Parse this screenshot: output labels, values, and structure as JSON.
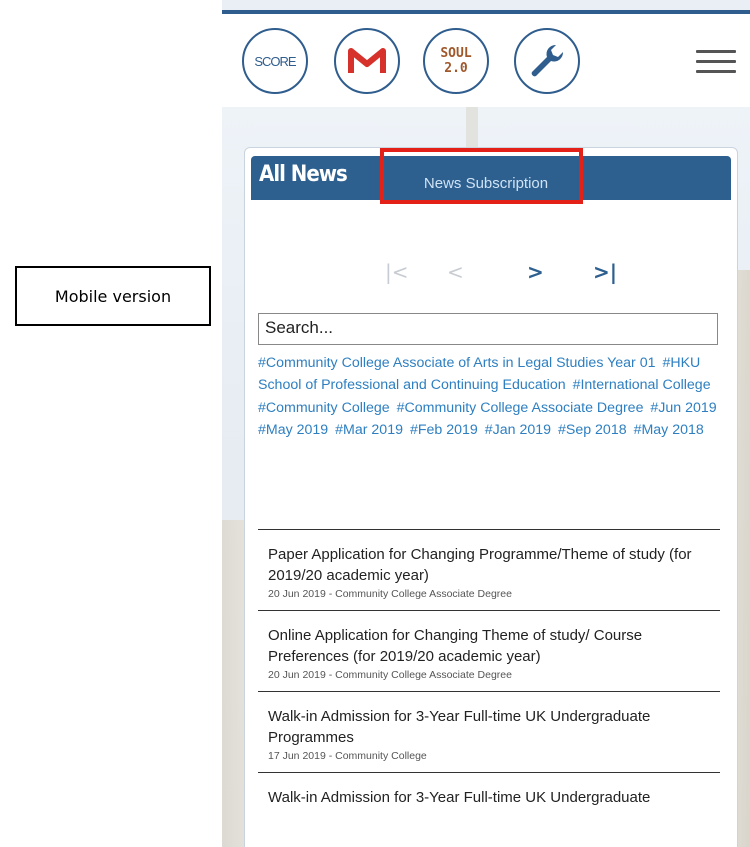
{
  "annotation": {
    "label": "Mobile version"
  },
  "topbar": {
    "icons": [
      {
        "name": "score-icon",
        "label": "SCORE"
      },
      {
        "name": "gmail-icon",
        "label": ""
      },
      {
        "name": "soul-icon",
        "label_line1": "SOUL",
        "label_line2": "2.0"
      },
      {
        "name": "wrench-icon",
        "label": ""
      }
    ],
    "menu_icon": "hamburger-menu-icon"
  },
  "news": {
    "heading": "All News",
    "subscription_label": "News Subscription",
    "pager": {
      "first": "|<",
      "prev": "<",
      "next": ">",
      "last": ">|"
    },
    "search_placeholder": "Search...",
    "tags": [
      "#Community College Associate of Arts in Legal Studies Year 01",
      "#HKU School of Professional and Continuing Education",
      "#International College",
      "#Community College",
      "#Community College Associate Degree",
      "#Jun 2019",
      "#May 2019",
      "#Mar 2019",
      "#Feb 2019",
      "#Jan 2019",
      "#Sep 2018",
      "#May 2018"
    ],
    "items": [
      {
        "title": "Paper Application for Changing Programme/Theme of study (for 2019/20 academic year)",
        "meta": "20 Jun 2019 - Community College Associate Degree"
      },
      {
        "title": "Online Application for Changing Theme of study/ Course Preferences (for 2019/20 academic year)",
        "meta": "20 Jun 2019 - Community College Associate Degree"
      },
      {
        "title": "Walk-in Admission for 3-Year Full-time UK Undergraduate Programmes",
        "meta": "17 Jun 2019 - Community College"
      },
      {
        "title": "Walk-in Admission for 3-Year Full-time UK Undergraduate",
        "meta": ""
      }
    ]
  },
  "colors": {
    "accent": "#2d5f8f",
    "highlight": "#e32119",
    "tag": "#2d7fc1"
  }
}
